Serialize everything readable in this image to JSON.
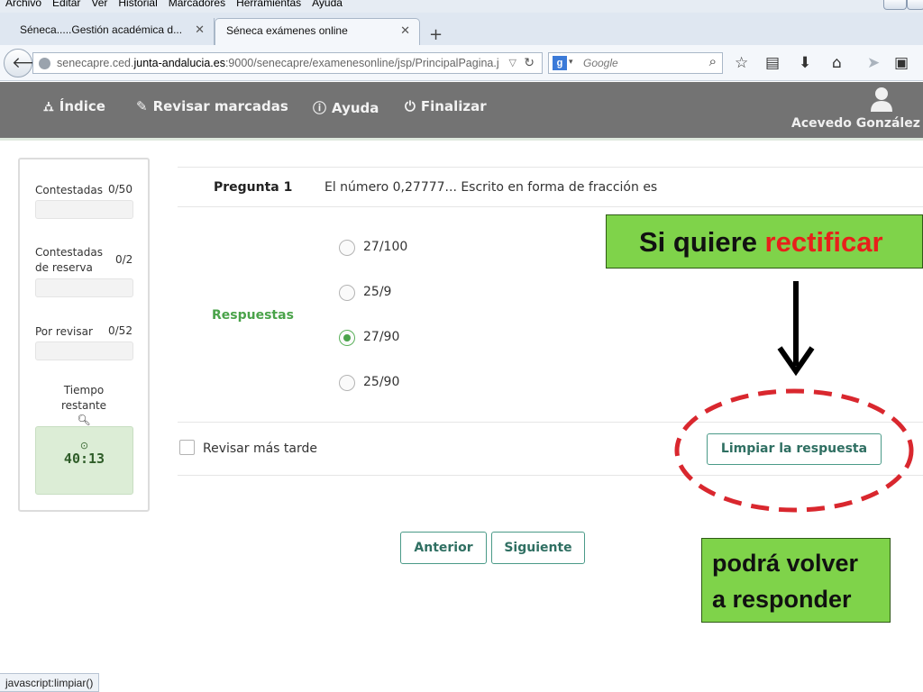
{
  "browser": {
    "menu": [
      "Archivo",
      "Editar",
      "Ver",
      "Historial",
      "Marcadores",
      "Herramientas",
      "Ayuda"
    ],
    "tabs": [
      {
        "label": "Séneca.....Gestión académica d...",
        "active": false
      },
      {
        "label": "Séneca exámenes online",
        "active": true
      }
    ],
    "url": {
      "prefix": "senecapre.ced.",
      "host": "junta-andalucia.es",
      "suffix": ":9000/senecapre/examenesonline/jsp/PrincipalPagina.j"
    },
    "search_placeholder": "Google",
    "status_text": "javascript:limpiar()"
  },
  "header": {
    "nav": [
      {
        "label": "Índice",
        "icon": "sitemap-icon"
      },
      {
        "label": "Revisar marcadas",
        "icon": "pencil-icon"
      },
      {
        "label": "Ayuda",
        "icon": "info-icon"
      },
      {
        "label": "Finalizar",
        "icon": "power-icon"
      }
    ],
    "user_name": "Acevedo González"
  },
  "sidebar": {
    "answered": {
      "label": "Contestadas",
      "count": "0/50"
    },
    "reserve": {
      "label_line1": "Contestadas",
      "label_line2": "de reserva",
      "count": "0/2"
    },
    "review": {
      "label": "Por revisar",
      "count": "0/52"
    },
    "time": {
      "label_line1": "Tiempo",
      "label_line2": "restante",
      "value": "40:13"
    }
  },
  "question": {
    "label": "Pregunta 1",
    "text": "El número 0,27777... Escrito en forma de fracción es",
    "answers_label": "Respuestas",
    "options": [
      {
        "label": "27/100",
        "checked": false
      },
      {
        "label": "25/9",
        "checked": false
      },
      {
        "label": "27/90",
        "checked": true
      },
      {
        "label": "25/90",
        "checked": false
      }
    ],
    "review_later_label": "Revisar más tarde",
    "clear_button": "Limpiar la respuesta"
  },
  "pagination": {
    "prev": "Anterior",
    "next": "Siguiente"
  },
  "annotations": {
    "callout1_prefix": "Si quiere ",
    "callout1_highlight": "rectificar",
    "callout2_line1": "podrá volver",
    "callout2_line2": "a responder",
    "highlight_color": "#e8201b",
    "box_color": "#7fd34a",
    "ellipse_color": "#d9272e"
  }
}
